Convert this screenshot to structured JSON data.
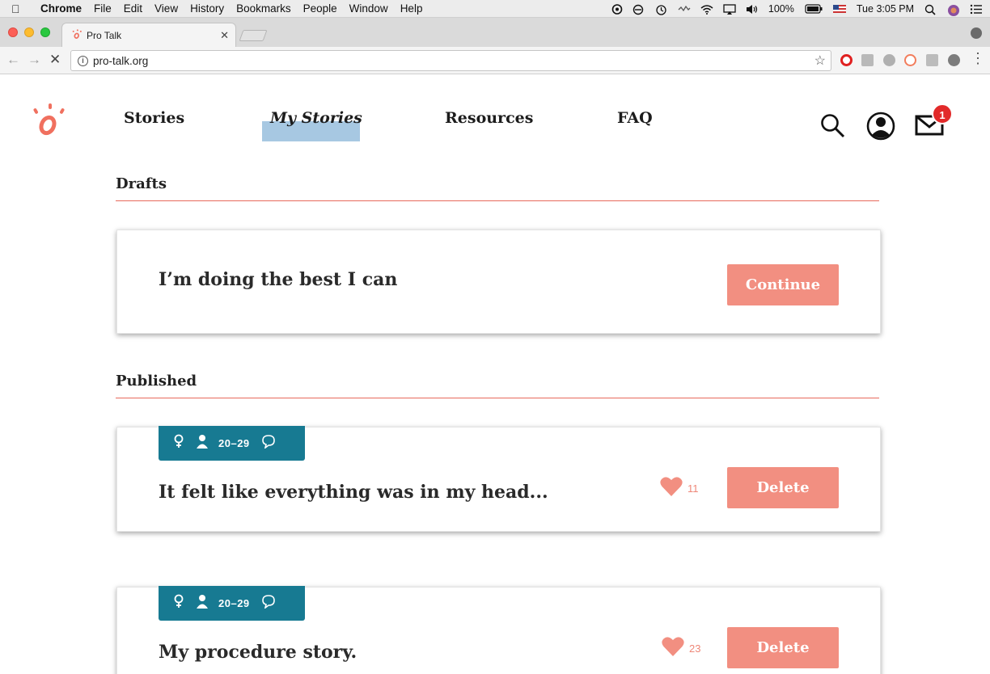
{
  "menubar": {
    "app": "Chrome",
    "items": [
      "File",
      "Edit",
      "View",
      "History",
      "Bookmarks",
      "People",
      "Window",
      "Help"
    ],
    "battery": "100%",
    "clock": "Tue 3:05 PM"
  },
  "browser": {
    "tab_title": "Pro Talk",
    "url": "pro-talk.org"
  },
  "nav": {
    "links": [
      "Stories",
      "My Stories",
      "Resources",
      "FAQ"
    ],
    "active": "My Stories",
    "mail_badge": "1"
  },
  "drafts": {
    "title": "Drafts",
    "items": [
      {
        "title": "I’m doing the best I can",
        "action": "Continue"
      }
    ]
  },
  "published": {
    "title": "Published",
    "items": [
      {
        "age": "20–29",
        "title": "It felt like everything was in my head...",
        "likes": "11",
        "action": "Delete"
      },
      {
        "age": "20–29",
        "title": "My procedure story.",
        "likes": "23",
        "action": "Delete"
      }
    ]
  },
  "colors": {
    "accent": "#f28f81",
    "divider": "#e7695c",
    "tag": "#177a92",
    "active_nav": "#a7c8e2"
  }
}
